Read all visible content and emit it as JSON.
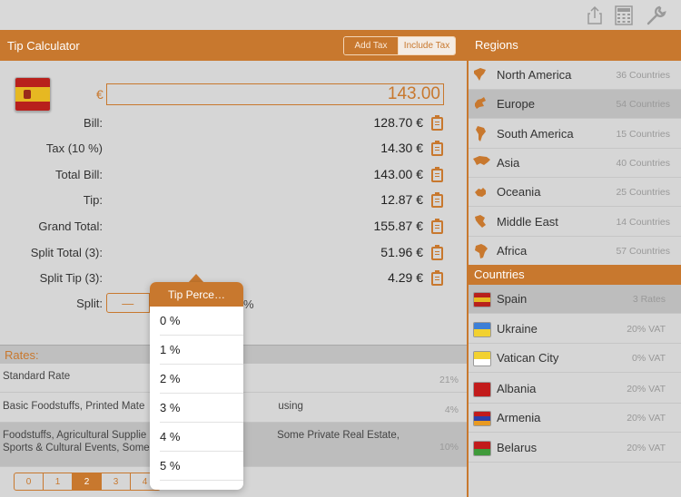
{
  "toolbar": {
    "share_icon": "share-icon",
    "calculator_icon": "calculator-icon",
    "settings_icon": "wrench-icon"
  },
  "calc": {
    "title": "Tip Calculator",
    "seg_add_tax": "Add Tax",
    "seg_include_tax": "Include Tax",
    "currency_symbol": "€",
    "amount": "143.00",
    "rows": [
      {
        "label": "Bill:",
        "value": "128.70 €"
      },
      {
        "label": "Tax (10 %)",
        "value": "14.30 €"
      },
      {
        "label": "Total Bill:",
        "value": "143.00 €"
      },
      {
        "label": "Tip:",
        "value": "12.87 €"
      },
      {
        "label": "Grand Total:",
        "value": "155.87 €"
      },
      {
        "label": "Split Total (3):",
        "value": "51.96 €"
      },
      {
        "label": "Split Tip (3):",
        "value": "4.29 €"
      }
    ],
    "split_label": "Split:",
    "stepper_minus": "—",
    "stepper_plus": "+",
    "split_suffix": "%"
  },
  "rates": {
    "header": "Rates:",
    "items": [
      {
        "text": "Standard Rate",
        "pct": "21%"
      },
      {
        "text": "Basic Foodstuffs, Printed Mate                                              using",
        "pct": "4%"
      },
      {
        "text": "Foodstuffs, Agricultural Supplie                                             Some Private Real Estate, Sports & Cultural Events, Some House F",
        "pct": "10%"
      }
    ]
  },
  "tip_tabs": [
    "0",
    "1",
    "2",
    "3",
    "4"
  ],
  "tip_tab_selected": 2,
  "popover": {
    "title": "Tip Perce…",
    "options": [
      "0 %",
      "1 %",
      "2 %",
      "3 %",
      "4 %",
      "5 %"
    ]
  },
  "regions": {
    "header": "Regions",
    "items": [
      {
        "name": "North America",
        "count": "36 Countries",
        "icon": "north-america-icon"
      },
      {
        "name": "Europe",
        "count": "54 Countries",
        "icon": "europe-icon"
      },
      {
        "name": "South America",
        "count": "15 Countries",
        "icon": "south-america-icon"
      },
      {
        "name": "Asia",
        "count": "40 Countries",
        "icon": "asia-icon"
      },
      {
        "name": "Oceania",
        "count": "25 Countries",
        "icon": "oceania-icon"
      },
      {
        "name": "Middle East",
        "count": "14 Countries",
        "icon": "middle-east-icon"
      },
      {
        "name": "Africa",
        "count": "57 Countries",
        "icon": "africa-icon"
      }
    ],
    "selected": 1
  },
  "countries": {
    "header": "Countries",
    "items": [
      {
        "name": "Spain",
        "rate": "3 Rates",
        "colors": [
          "#b8201c",
          "#e6b822",
          "#b8201c"
        ]
      },
      {
        "name": "Ukraine",
        "rate": "20% VAT",
        "colors": [
          "#3d7fd6",
          "#f2d130"
        ]
      },
      {
        "name": "Vatican City",
        "rate": "0% VAT",
        "colors": [
          "#f2d130",
          "#ffffff"
        ]
      },
      {
        "name": "Albania",
        "rate": "20% VAT",
        "colors": [
          "#c21b1b",
          "#c21b1b"
        ]
      },
      {
        "name": "Armenia",
        "rate": "20% VAT",
        "colors": [
          "#c21b1b",
          "#2c3fa8",
          "#e89a22"
        ]
      },
      {
        "name": "Belarus",
        "rate": "20% VAT",
        "colors": [
          "#c21b1b",
          "#3f9a3a"
        ]
      }
    ],
    "selected": 0
  },
  "colors": {
    "accent": "#c8782e",
    "background": "#d6d6d6"
  }
}
